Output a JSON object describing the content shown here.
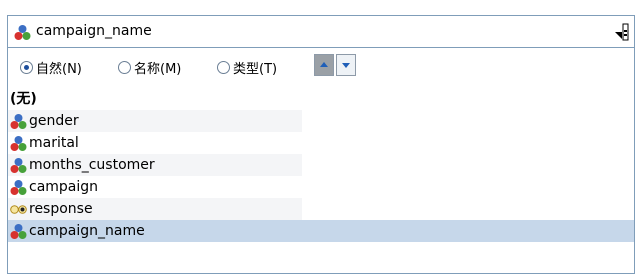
{
  "field_selector": {
    "value": "campaign_name",
    "field_icon": "set-field-icon",
    "dropdown_icon": "dropdown-arrow-icon"
  },
  "sort": {
    "options": [
      {
        "label": "自然(N)",
        "checked": true
      },
      {
        "label": "名称(M)",
        "checked": false
      },
      {
        "label": "类型(T)",
        "checked": false
      }
    ],
    "ascending_icon": "sort-ascending-icon",
    "descending_icon": "sort-descending-icon"
  },
  "fields": [
    {
      "label": "(无)",
      "icon": "",
      "selected": false
    },
    {
      "label": "gender",
      "icon": "set-field-icon",
      "selected": false
    },
    {
      "label": "marital",
      "icon": "set-field-icon",
      "selected": false
    },
    {
      "label": "months_customer",
      "icon": "set-field-icon",
      "selected": false
    },
    {
      "label": "campaign",
      "icon": "set-field-icon",
      "selected": false
    },
    {
      "label": "response",
      "icon": "flag-field-icon",
      "selected": false
    },
    {
      "label": "campaign_name",
      "icon": "set-field-icon",
      "selected": true
    }
  ],
  "colors": {
    "border": "#7f9db9",
    "selection": "#c6d7ea",
    "set_icon_red": "#d7322f",
    "set_icon_blue": "#3c6fc4",
    "set_icon_green": "#47a13a"
  }
}
